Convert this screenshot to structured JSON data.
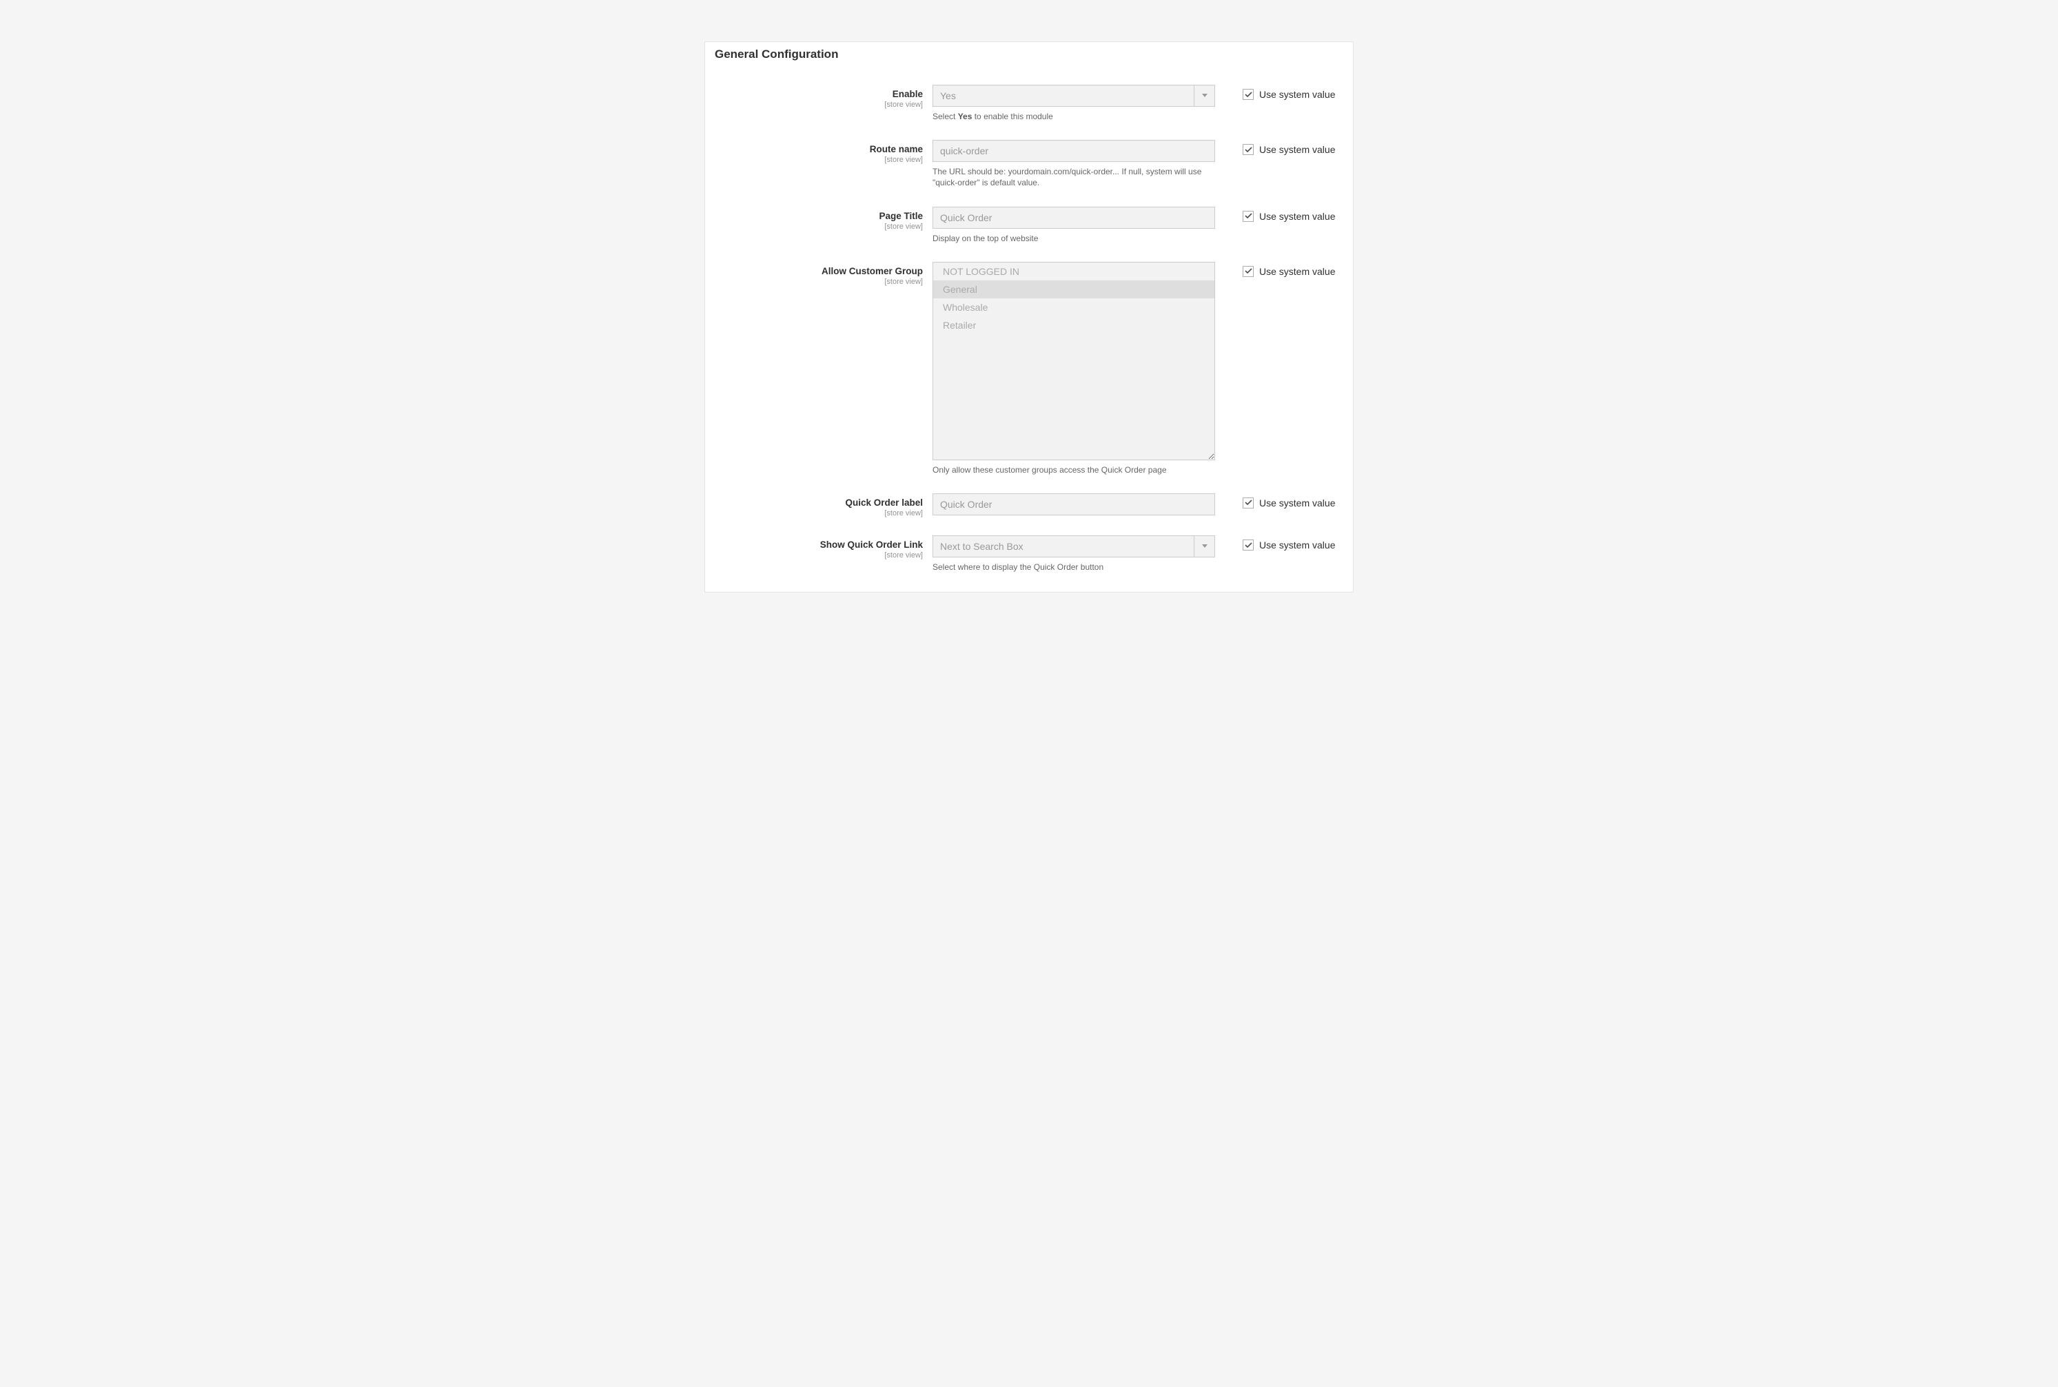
{
  "section_title": "General Configuration",
  "scope_label": "[store view]",
  "use_system_label": "Use system value",
  "fields": {
    "enable": {
      "label": "Enable",
      "value": "Yes",
      "help_prefix": "Select ",
      "help_bold": "Yes",
      "help_suffix": " to enable this module",
      "use_system": true
    },
    "route_name": {
      "label": "Route name",
      "value": "quick-order",
      "help": "The URL should be: yourdomain.com/quick-order... If null, system will use \"quick-order\" is default value.",
      "use_system": true
    },
    "page_title": {
      "label": "Page Title",
      "value": "Quick Order",
      "help": "Display on the top of website",
      "use_system": true
    },
    "customer_group": {
      "label": "Allow Customer Group",
      "options": [
        "NOT LOGGED IN",
        "General",
        "Wholesale",
        "Retailer"
      ],
      "selected_index": 1,
      "help": "Only allow these customer groups access the Quick Order page",
      "use_system": true
    },
    "quick_order_label": {
      "label": "Quick Order label",
      "value": "Quick Order",
      "use_system": true
    },
    "show_link": {
      "label": "Show Quick Order Link",
      "value": "Next to Search Box",
      "help": "Select where to display the Quick Order button",
      "use_system": true
    }
  }
}
